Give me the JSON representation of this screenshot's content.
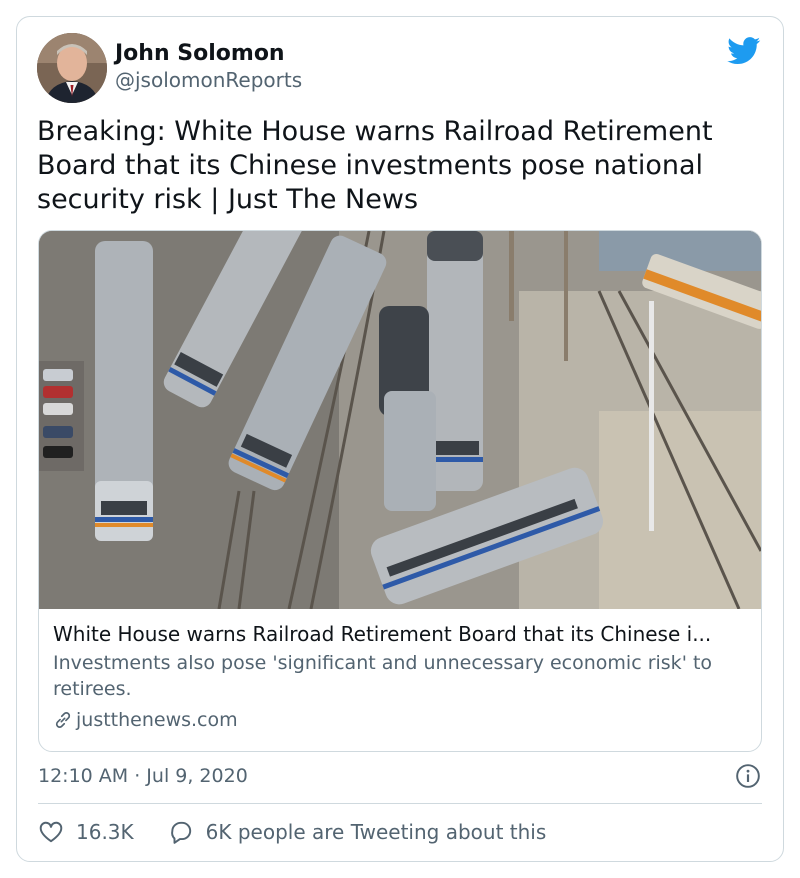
{
  "author": {
    "name": "John Solomon",
    "handle": "@jsolomonReports"
  },
  "tweet_text": "Breaking: White House warns Railroad Retirement Board that its Chinese investments pose national security risk | Just The News",
  "card": {
    "title": "White House warns Railroad Retirement Board that its Chinese i...",
    "description": "Investments also pose 'significant and unnecessary economic risk' to retirees.",
    "domain": "justthenews.com"
  },
  "timestamp": "12:10 AM · Jul 9, 2020",
  "actions": {
    "likes": "16.3K",
    "conversation": "6K people are Tweeting about this"
  },
  "colors": {
    "twitter_blue": "#1d9bf0",
    "secondary_text": "#536471",
    "border": "#cfd9de"
  },
  "icons": [
    "twitter-bird-icon",
    "link-icon",
    "info-icon",
    "heart-icon",
    "speech-bubble-icon"
  ]
}
